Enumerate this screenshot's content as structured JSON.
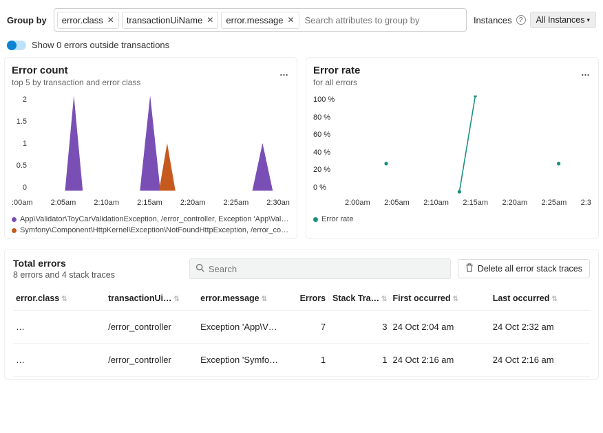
{
  "header": {
    "groupby_label": "Group by",
    "chips": [
      "error.class",
      "transactionUiName",
      "error.message"
    ],
    "search_placeholder": "Search attributes to group by",
    "instances_label": "Instances",
    "instances_dropdown": "All Instances"
  },
  "toggle": {
    "label": "Show 0 errors outside transactions"
  },
  "cards": {
    "count": {
      "title": "Error count",
      "subtitle": "top 5 by transaction and error class",
      "y_ticks": [
        "2",
        "1.5",
        "1",
        "0.5",
        "0"
      ],
      "x_ticks": [
        ":00am",
        "2:05am",
        "2:10am",
        "2:15am",
        "2:20am",
        "2:25am",
        "2:30an"
      ],
      "legend1": "App\\Validator\\ToyCarValidationException, /error_controller, Exception 'App\\Vali…",
      "legend2": "Symfony\\Component\\HttpKernel\\Exception\\NotFoundHttpException, /error_co…"
    },
    "rate": {
      "title": "Error rate",
      "subtitle": "for all errors",
      "y_ticks": [
        "100 %",
        "80 %",
        "60 %",
        "40 %",
        "20 %",
        "0 %"
      ],
      "x_ticks": [
        "2:00am",
        "2:05am",
        "2:10am",
        "2:15am",
        "2:20am",
        "2:25am",
        "2:3"
      ],
      "legend": "Error rate"
    }
  },
  "table_header": {
    "title": "Total errors",
    "subtitle": "8 errors and 4 stack traces",
    "search_placeholder": "Search",
    "delete_label": "Delete all error stack traces"
  },
  "columns": {
    "c1": "error.class",
    "c2": "transactionUi…",
    "c3": "error.message",
    "c4": "Errors",
    "c5": "Stack Tra…",
    "c6": "First occurred",
    "c7": "Last occurred"
  },
  "rows": [
    {
      "c1": "…",
      "c2": "/error_controller",
      "c3": "Exception 'App\\V…",
      "c4": "7",
      "c5": "3",
      "c6": "24 Oct 2:04 am",
      "c7": "24 Oct 2:32 am"
    },
    {
      "c1": "…",
      "c2": "/error_controller",
      "c3": "Exception 'Symfo…",
      "c4": "1",
      "c5": "1",
      "c6": "24 Oct 2:16 am",
      "c7": "24 Oct 2:16 am"
    }
  ],
  "chart_data": [
    {
      "type": "area",
      "title": "Error count",
      "subtitle": "top 5 by transaction and error class",
      "xlabel": "",
      "ylabel": "",
      "ylim": [
        0,
        2
      ],
      "x": [
        "2:00am",
        "2:01am",
        "2:02am",
        "2:03am",
        "2:04am",
        "2:05am",
        "2:06am",
        "2:07am",
        "2:08am",
        "2:09am",
        "2:10am",
        "2:11am",
        "2:12am",
        "2:13am",
        "2:14am",
        "2:15am",
        "2:16am",
        "2:17am",
        "2:18am",
        "2:19am",
        "2:20am",
        "2:21am",
        "2:22am",
        "2:23am",
        "2:24am",
        "2:25am",
        "2:26am",
        "2:27am",
        "2:28am",
        "2:29am",
        "2:30am"
      ],
      "series": [
        {
          "name": "App\\Validator\\ToyCarValidationException, /error_controller, Exception 'App\\Vali…",
          "color": "#7a4fb5",
          "values": [
            0,
            0,
            0,
            0,
            0,
            2,
            0,
            0,
            0,
            0,
            0,
            0,
            0,
            0,
            2,
            0,
            0,
            0,
            0,
            0,
            0,
            0,
            0,
            0,
            0,
            0,
            0,
            1,
            0,
            0,
            0
          ]
        },
        {
          "name": "Symfony\\Component\\HttpKernel\\Exception\\NotFoundHttpException, /error_co…",
          "color": "#c65a1e",
          "values": [
            0,
            0,
            0,
            0,
            0,
            0,
            0,
            0,
            0,
            0,
            0,
            0,
            0,
            0,
            0,
            0,
            1,
            0,
            0,
            0,
            0,
            0,
            0,
            0,
            0,
            0,
            0,
            0,
            0,
            0,
            0
          ]
        }
      ]
    },
    {
      "type": "scatter",
      "title": "Error rate",
      "subtitle": "for all errors",
      "xlabel": "",
      "ylabel": "%",
      "ylim": [
        0,
        100
      ],
      "series": [
        {
          "name": "Error rate",
          "color": "#1a9081",
          "points": [
            {
              "x": "2:05am",
              "y": 33
            },
            {
              "x": "2:14am",
              "y": 5
            },
            {
              "x": "2:16am",
              "y": 100
            },
            {
              "x": "2:26am",
              "y": 33
            }
          ]
        }
      ]
    }
  ]
}
